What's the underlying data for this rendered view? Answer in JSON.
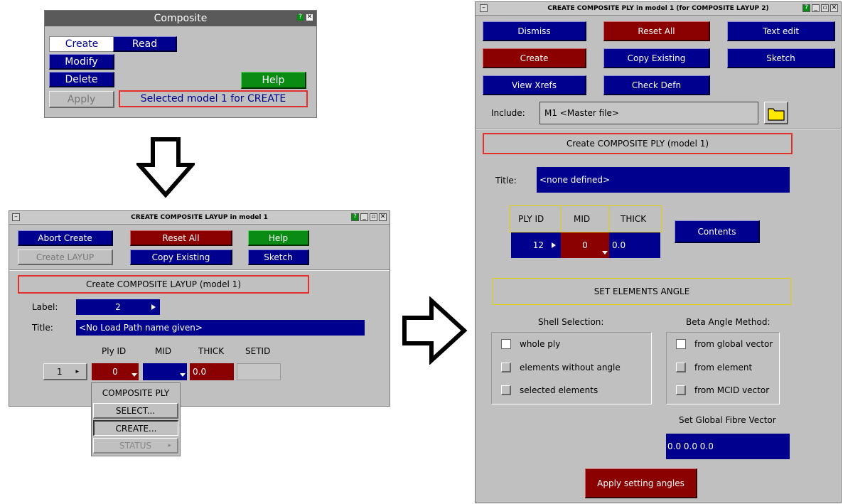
{
  "composite_panel": {
    "title": "Composite",
    "create": "Create",
    "read": "Read",
    "modify": "Modify",
    "delete": "Delete",
    "apply": "Apply",
    "help": "Help",
    "status": "Selected model 1 for CREATE"
  },
  "layup_panel": {
    "title": "CREATE COMPOSITE LAYUP in model 1",
    "abort_create": "Abort Create",
    "reset_all": "Reset All",
    "help": "Help",
    "create_layup": "Create LAYUP",
    "copy_existing": "Copy Existing",
    "sketch": "Sketch",
    "heading": "Create COMPOSITE LAYUP (model 1)",
    "label_label": "Label:",
    "label_value": "2",
    "title_label": "Title:",
    "title_value": "<No Load Path name given>",
    "col_ply_id": "Ply ID",
    "col_mid": "MID",
    "col_thick": "THICK",
    "col_setid": "SETID",
    "row_index": "1",
    "ply_id_value": "0",
    "thick_value": "0.0",
    "popup": {
      "header": "COMPOSITE PLY",
      "select": "SELECT...",
      "create": "CREATE...",
      "status": "STATUS"
    }
  },
  "ply_panel": {
    "title": "CREATE COMPOSITE PLY in model 1 (for COMPOSITE LAYUP 2)",
    "dismiss": "Dismiss",
    "reset_all": "Reset All",
    "text_edit": "Text edit",
    "create": "Create",
    "copy_existing": "Copy Existing",
    "sketch": "Sketch",
    "view_xrefs": "View Xrefs",
    "check_defn": "Check Defn",
    "include_label": "Include:",
    "include_value": "M1  <Master file>",
    "heading": "Create COMPOSITE PLY (model 1)",
    "title_label": "Title:",
    "title_value": "<none defined>",
    "col_ply_id": "PLY ID",
    "col_mid": "MID",
    "col_thick": "THICK",
    "ply_id_value": "12",
    "mid_value": "0",
    "thick_value": "0.0",
    "contents": "Contents",
    "set_angle": "SET ELEMENTS ANGLE",
    "shell_selection": "Shell Selection:",
    "beta_method": "Beta Angle Method:",
    "opt_whole_ply": "whole ply",
    "opt_elements_without_angle": "elements without angle",
    "opt_selected_elements": "selected elements",
    "opt_global_vector": "from global vector",
    "opt_from_element": "from element",
    "opt_mcid_vector": "from MCID vector",
    "fibre_label": "Set Global Fibre Vector",
    "fibre_value": "0.0  0.0  0.0",
    "apply_angles": "Apply setting angles"
  },
  "icons": [
    "down-arrow-icon",
    "right-arrow-icon",
    "folder-icon"
  ]
}
